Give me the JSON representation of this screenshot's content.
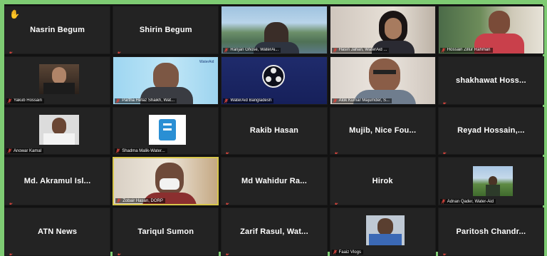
{
  "colors": {
    "frame": "#7ecb73",
    "tile_bg": "#232323",
    "active_border": "#d7c64b",
    "mic_muted": "#d6453d"
  },
  "hand_icon": "✋",
  "participants": [
    {
      "type": "name",
      "name": "Nasrin Begum",
      "hand": true
    },
    {
      "type": "name",
      "name": "Shirin Begum"
    },
    {
      "type": "video",
      "label": "Ranjan Ghose, WaterAi...",
      "scene": "lake"
    },
    {
      "type": "video",
      "label": "Hasin Jahan, WaterAid ...",
      "scene": "woman"
    },
    {
      "type": "video",
      "label": "Hossain Zillur Rahman",
      "scene": "room"
    },
    {
      "type": "thumb",
      "label": "Yakub Hossain",
      "scene": "man-dark"
    },
    {
      "type": "video",
      "label": "Partha Hefaz Shaikh, Wat...",
      "scene": "blue-office"
    },
    {
      "type": "video",
      "label": "WaterAid Bangladesh",
      "scene": "obs"
    },
    {
      "type": "video",
      "label": "Alok Kumar Majumder, S...",
      "scene": "man-glasses"
    },
    {
      "type": "name",
      "name": "shakhawat Hoss..."
    },
    {
      "type": "thumb",
      "label": "Anowar Kamal",
      "scene": "man-white"
    },
    {
      "type": "thumb",
      "label": "Shadma Malik-Water...",
      "scene": "logo"
    },
    {
      "type": "name",
      "name": "Rakib Hasan"
    },
    {
      "type": "name",
      "name": "Mujib, Nice Fou..."
    },
    {
      "type": "name",
      "name": "Reyad Hossain,..."
    },
    {
      "type": "name",
      "name": "Md. Akramul Isl..."
    },
    {
      "type": "video",
      "label": "Zobair Hasan, DORP",
      "scene": "mask",
      "active": true
    },
    {
      "type": "name",
      "name": "Md Wahidur Ra..."
    },
    {
      "type": "name",
      "name": "Hirok"
    },
    {
      "type": "thumb",
      "label": "Adnan Qader, Water-Aid",
      "scene": "field"
    },
    {
      "type": "name",
      "name": "ATN News"
    },
    {
      "type": "name",
      "name": "Tariqul Sumon"
    },
    {
      "type": "name",
      "name": "Zarif Rasul, Wat..."
    },
    {
      "type": "thumb",
      "label": "Faaiz Vlogs",
      "scene": "man-blue"
    },
    {
      "type": "name",
      "name": "Paritosh Chandr..."
    }
  ]
}
